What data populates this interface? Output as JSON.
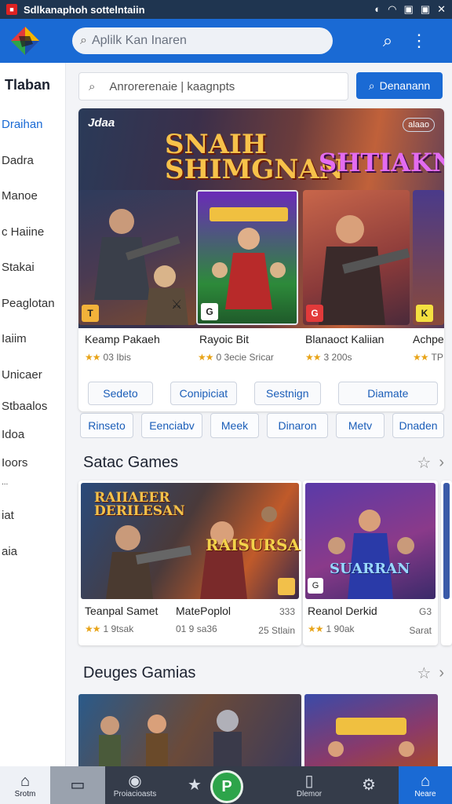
{
  "statusbar": {
    "app_title": "Sdlkanaphoh sottelntaiin",
    "icons": [
      "vpn-icon",
      "wifi-icon",
      "image-icon",
      "gallery-icon",
      "x-icon"
    ]
  },
  "appbar": {
    "search_placeholder": "Aplilk Kan Inaren"
  },
  "sidebar": {
    "heading": "Tlaban",
    "items": [
      {
        "label": "Draihan",
        "active": true
      },
      {
        "label": "Dadra"
      },
      {
        "label": "Manoe"
      },
      {
        "label": "c Haiine"
      },
      {
        "label": "Stakai"
      },
      {
        "label": "Peaglotan"
      },
      {
        "label": "Iaiim"
      },
      {
        "label": "Unicaer"
      },
      {
        "label": "Stbaalos"
      },
      {
        "label": "Idoa"
      },
      {
        "label": "Ioors"
      },
      {
        "label": "..."
      },
      {
        "label": "iat"
      },
      {
        "label": "aia"
      }
    ]
  },
  "main_search": {
    "placeholder": "Anrorerenaie  |  kaagnpts",
    "button_label": "Denanann"
  },
  "featured": {
    "badge_left": "Jdaa",
    "badge_right": "alaao",
    "logo_a": "SNAIH SHIMGNAN",
    "logo_b": "SHTIAKN",
    "games": [
      {
        "title": "Keamp Pakaeh",
        "rating": "★★",
        "meta": "03 Ibis"
      },
      {
        "title": "Rayoic Bit",
        "rating": "★★",
        "meta": "0 3ecie Sricar"
      },
      {
        "title": "Blanaoct Kaliian",
        "rating": "★★",
        "meta": "3 200s"
      },
      {
        "title": "Achpe",
        "rating": "★★",
        "meta": "TP"
      }
    ],
    "chips": [
      "Sedeto",
      "Conipiciat",
      "Sestnign",
      "Diamate"
    ]
  },
  "chips_row2": [
    "Rinseto",
    "Eenciabv",
    "Meek",
    "Dinaron",
    "Metv",
    "Dnaden"
  ],
  "section1": {
    "title": "Satac Games",
    "cards": [
      {
        "title": "Teanpal Samet",
        "rating": "★★",
        "meta": "1 9tsak",
        "logo": "RAIIAEER DERILESAN"
      },
      {
        "title": "MatePoplol",
        "meta": "01 9 sa36",
        "right_top": "333",
        "right_bottom": "25 Stlain",
        "logo": "RAISURSAN"
      },
      {
        "title": "Reanol Derkid",
        "rating": "★★",
        "meta": "1 90ak",
        "right_top": "G3",
        "right_bottom": "Sarat",
        "logo": "SUARRAN"
      }
    ]
  },
  "section2": {
    "title": "Deuges Gamias"
  },
  "bottomnav": {
    "tabs": [
      {
        "label": "Srotm",
        "icon": "home-icon"
      },
      {
        "label": "",
        "icon": "book-icon"
      },
      {
        "label": "Proiacioasts",
        "icon": "location-icon"
      },
      {
        "label": "",
        "icon": "star-icon"
      },
      {
        "label": "",
        "icon": "play-icon"
      },
      {
        "label": "Dlemor",
        "icon": "book-open-icon"
      },
      {
        "label": "",
        "icon": "gear-icon"
      },
      {
        "label": "Neare",
        "icon": "bag-icon"
      }
    ]
  },
  "colors": {
    "primary": "#1a6ad4",
    "statusbar": "#1f3550",
    "star": "#e8a419"
  }
}
